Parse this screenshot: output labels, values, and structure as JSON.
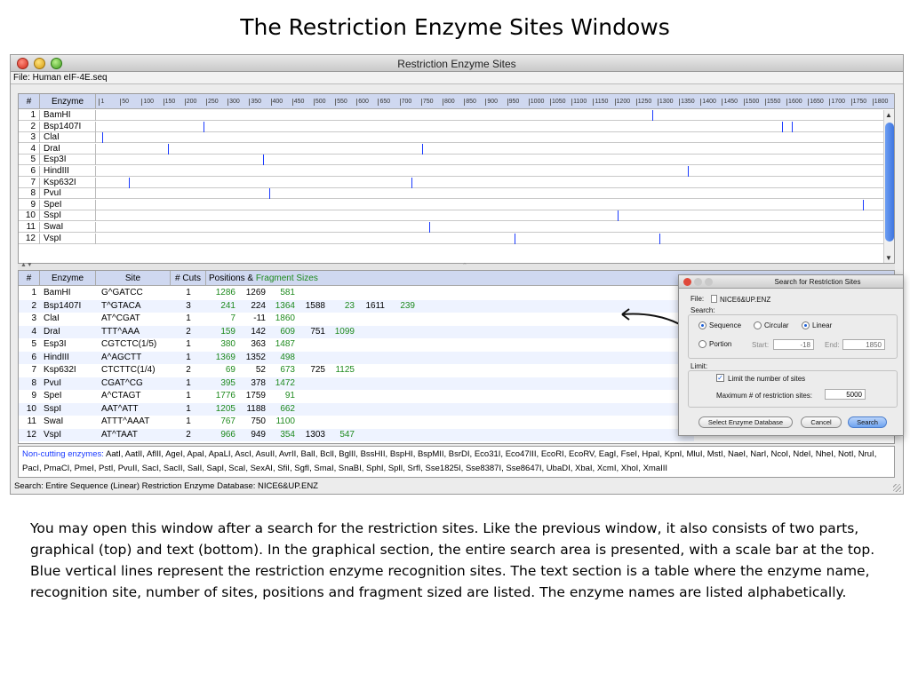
{
  "slide": {
    "title": "The Restriction Enzyme Sites Windows",
    "description": "You may open this window after a search for the restriction sites. Like the previous window, it also consists of two parts, graphical (top) and text (bottom). In the graphical section, the entire search area is presented, with a scale bar at the top. Blue vertical lines represent the restriction enzyme recognition sites. The text section is a table where the enzyme name, recognition site, number of sites, positions and fragment sized are listed. The enzyme names are listed alphabetically."
  },
  "window": {
    "title": "Restriction Enzyme Sites",
    "file_label": "File: Human eIF-4E.seq"
  },
  "graph": {
    "col_num": "#",
    "col_enzyme": "Enzyme",
    "scale_max": 1850,
    "scale_ticks": [
      "1",
      "50",
      "100",
      "150",
      "200",
      "250",
      "300",
      "350",
      "400",
      "450",
      "500",
      "550",
      "600",
      "650",
      "700",
      "750",
      "800",
      "850",
      "900",
      "950",
      "1000",
      "1050",
      "1100",
      "1150",
      "1200",
      "1250",
      "1300",
      "1350",
      "1400",
      "1450",
      "1500",
      "1550",
      "1600",
      "1650",
      "1700",
      "1750",
      "1800"
    ],
    "rows": [
      {
        "num": "1",
        "enzyme": "BamHI",
        "sites": [
          1286
        ]
      },
      {
        "num": "2",
        "enzyme": "Bsp1407I",
        "sites": [
          241,
          1588,
          1611
        ]
      },
      {
        "num": "3",
        "enzyme": "ClaI",
        "sites": [
          7
        ]
      },
      {
        "num": "4",
        "enzyme": "DraI",
        "sites": [
          159,
          751
        ]
      },
      {
        "num": "5",
        "enzyme": "Esp3I",
        "sites": [
          380
        ]
      },
      {
        "num": "6",
        "enzyme": "HindIII",
        "sites": [
          1369
        ]
      },
      {
        "num": "7",
        "enzyme": "Ksp632I",
        "sites": [
          69,
          725
        ]
      },
      {
        "num": "8",
        "enzyme": "PvuI",
        "sites": [
          395
        ]
      },
      {
        "num": "9",
        "enzyme": "SpeI",
        "sites": [
          1776
        ]
      },
      {
        "num": "10",
        "enzyme": "SspI",
        "sites": [
          1205
        ]
      },
      {
        "num": "11",
        "enzyme": "SwaI",
        "sites": [
          767
        ]
      },
      {
        "num": "12",
        "enzyme": "VspI",
        "sites": [
          966,
          1303
        ]
      }
    ]
  },
  "table": {
    "headers": {
      "num": "#",
      "enzyme": "Enzyme",
      "site": "Site",
      "cuts": "# Cuts",
      "positions": "Positions & ",
      "fragments": "Fragment Sizes"
    },
    "rows": [
      {
        "num": "1",
        "enzyme": "BamHI",
        "site": "G^GATCC",
        "cuts": "1",
        "vals": [
          [
            "1286",
            "g"
          ],
          [
            "1269",
            "k"
          ],
          [
            "581",
            "g"
          ]
        ]
      },
      {
        "num": "2",
        "enzyme": "Bsp1407I",
        "site": "T^GTACA",
        "cuts": "3",
        "vals": [
          [
            "241",
            "g"
          ],
          [
            "224",
            "k"
          ],
          [
            "1364",
            "g"
          ],
          [
            "1588",
            "k"
          ],
          [
            "23",
            "g"
          ],
          [
            "1611",
            "k"
          ],
          [
            "239",
            "g"
          ]
        ]
      },
      {
        "num": "3",
        "enzyme": "ClaI",
        "site": "AT^CGAT",
        "cuts": "1",
        "vals": [
          [
            "7",
            "g"
          ],
          [
            "-11",
            "k"
          ],
          [
            "1860",
            "g"
          ]
        ]
      },
      {
        "num": "4",
        "enzyme": "DraI",
        "site": "TTT^AAA",
        "cuts": "2",
        "vals": [
          [
            "159",
            "g"
          ],
          [
            "142",
            "k"
          ],
          [
            "609",
            "g"
          ],
          [
            "751",
            "k"
          ],
          [
            "1099",
            "g"
          ]
        ]
      },
      {
        "num": "5",
        "enzyme": "Esp3I",
        "site": "CGTCTC(1/5)",
        "cuts": "1",
        "vals": [
          [
            "380",
            "g"
          ],
          [
            "363",
            "k"
          ],
          [
            "1487",
            "g"
          ]
        ]
      },
      {
        "num": "6",
        "enzyme": "HindIII",
        "site": "A^AGCTT",
        "cuts": "1",
        "vals": [
          [
            "1369",
            "g"
          ],
          [
            "1352",
            "k"
          ],
          [
            "498",
            "g"
          ]
        ]
      },
      {
        "num": "7",
        "enzyme": "Ksp632I",
        "site": "CTCTTC(1/4)",
        "cuts": "2",
        "vals": [
          [
            "69",
            "g"
          ],
          [
            "52",
            "k"
          ],
          [
            "673",
            "g"
          ],
          [
            "725",
            "k"
          ],
          [
            "1125",
            "g"
          ]
        ]
      },
      {
        "num": "8",
        "enzyme": "PvuI",
        "site": "CGAT^CG",
        "cuts": "1",
        "vals": [
          [
            "395",
            "g"
          ],
          [
            "378",
            "k"
          ],
          [
            "1472",
            "g"
          ]
        ]
      },
      {
        "num": "9",
        "enzyme": "SpeI",
        "site": "A^CTAGT",
        "cuts": "1",
        "vals": [
          [
            "1776",
            "g"
          ],
          [
            "1759",
            "k"
          ],
          [
            "91",
            "g"
          ]
        ]
      },
      {
        "num": "10",
        "enzyme": "SspI",
        "site": "AAT^ATT",
        "cuts": "1",
        "vals": [
          [
            "1205",
            "g"
          ],
          [
            "1188",
            "k"
          ],
          [
            "662",
            "g"
          ]
        ]
      },
      {
        "num": "11",
        "enzyme": "SwaI",
        "site": "ATTT^AAAT",
        "cuts": "1",
        "vals": [
          [
            "767",
            "g"
          ],
          [
            "750",
            "k"
          ],
          [
            "1100",
            "g"
          ]
        ]
      },
      {
        "num": "12",
        "enzyme": "VspI",
        "site": "AT^TAAT",
        "cuts": "2",
        "vals": [
          [
            "966",
            "g"
          ],
          [
            "949",
            "k"
          ],
          [
            "354",
            "g"
          ],
          [
            "1303",
            "k"
          ],
          [
            "547",
            "g"
          ]
        ]
      }
    ]
  },
  "noncutting": {
    "label": "Non-cutting enzymes: ",
    "text": "AatI, AatII, AflII, AgeI, ApaI, ApaLI, AscI, AsuII, AvrII, BalI, BclI, BglII, BssHII, BspHI, BspMII, BsrDI, Eco31I, Eco47III, EcoRI, EcoRV, EagI, FseI, HpaI, KpnI, MluI, MstI, NaeI, NarI, NcoI, NdeI, NheI, NotI, NruI, PacI, PmaCI, PmeI, PstI, PvuII, SacI, SacII, SalI, SapI, ScaI, SexAI, SfiI, SgfI, SmaI, SnaBI, SphI, SplI, SrfI, Sse1825I, Sse8387I, Sse8647I, UbaDI, XbaI, XcmI, XhoI, XmaIII"
  },
  "status": {
    "text": "Search: Entire Sequence (Linear)   Restriction Enzyme Database: NICE6&UP.ENZ"
  },
  "dialog": {
    "title": "Search for Restriction Sites",
    "file_label": "File:",
    "file_name": "NICE6&UP.ENZ",
    "search_label": "Search:",
    "opt_sequence": "Sequence",
    "opt_circular": "Circular",
    "opt_linear": "Linear",
    "opt_portion": "Portion",
    "start_label": "Start:",
    "start_value": "-18",
    "end_label": "End:",
    "end_value": "1850",
    "limit_label": "Limit:",
    "limit_check": "Limit the number of sites",
    "max_label": "Maximum # of restriction sites:",
    "max_value": "5000",
    "btn_select_db": "Select Enzyme Database",
    "btn_cancel": "Cancel",
    "btn_search": "Search"
  },
  "colors": {
    "site_line": "#1a3aff",
    "fragment_green": "#1e8a1e",
    "header_blue": "#cfd8f0"
  }
}
